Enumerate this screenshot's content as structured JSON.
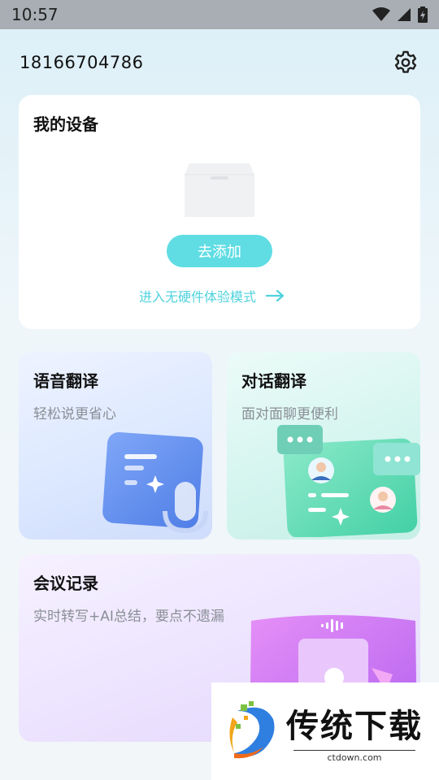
{
  "status_bar": {
    "time": "10:57"
  },
  "header": {
    "phone": "18166704786",
    "settings_icon": "gear-icon"
  },
  "device_card": {
    "title": "我的设备",
    "add_label": "去添加",
    "trial_label": "进入无硬件体验模式"
  },
  "features": [
    {
      "title": "语音翻译",
      "subtitle": "轻松说更省心"
    },
    {
      "title": "对话翻译",
      "subtitle": "面对面聊更便利"
    },
    {
      "title": "会议记录",
      "subtitle": "实时转写+AI总结，要点不遗漏"
    }
  ],
  "watermark": {
    "title": "传统下载",
    "url": "ctdown.com"
  },
  "colors": {
    "accent": "#5fdde3",
    "link": "#4fd2dd"
  }
}
